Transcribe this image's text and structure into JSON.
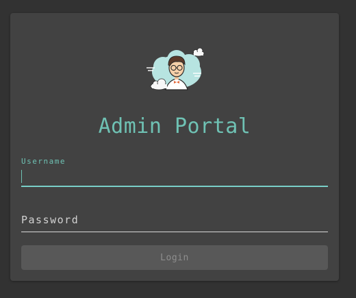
{
  "login_card": {
    "avatar_icon": "developer-avatar-with-clouds-icon",
    "title": "Admin Portal",
    "username": {
      "label": "Username",
      "value": ""
    },
    "password": {
      "placeholder": "Password",
      "value": ""
    },
    "login_button_label": "Login"
  },
  "colors": {
    "background": "#323232",
    "card": "#424242",
    "accent": "#6fc2b4",
    "button_disabled": "#585858"
  }
}
